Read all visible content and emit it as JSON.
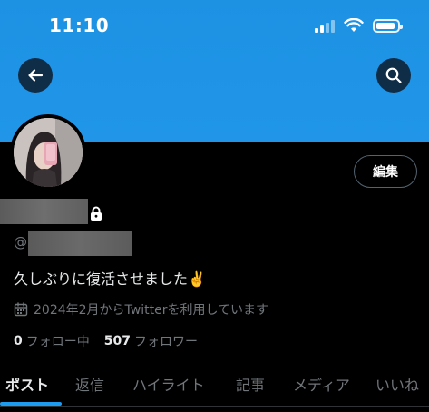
{
  "status_bar": {
    "time": "11:10"
  },
  "header": {
    "back_icon": "arrow-left-icon",
    "search_icon": "search-icon",
    "banner_color": "#1d92e3"
  },
  "profile": {
    "edit_label": "編集",
    "handle_prefix": "@",
    "bio": "久しぶりに復活させました✌️",
    "joined": "2024年2月からTwitterを利用しています",
    "following_count": "0",
    "following_label": "フォロー中",
    "followers_count": "507",
    "followers_label": "フォロワー"
  },
  "tabs": [
    {
      "label": "ポスト",
      "active": true
    },
    {
      "label": "返信",
      "active": false
    },
    {
      "label": "ハイライト",
      "active": false
    },
    {
      "label": "記事",
      "active": false
    },
    {
      "label": "メディア",
      "active": false
    },
    {
      "label": "いいね",
      "active": false
    }
  ],
  "colors": {
    "accent": "#1d9bf0",
    "background": "#000000",
    "secondary_text": "#71767b"
  }
}
